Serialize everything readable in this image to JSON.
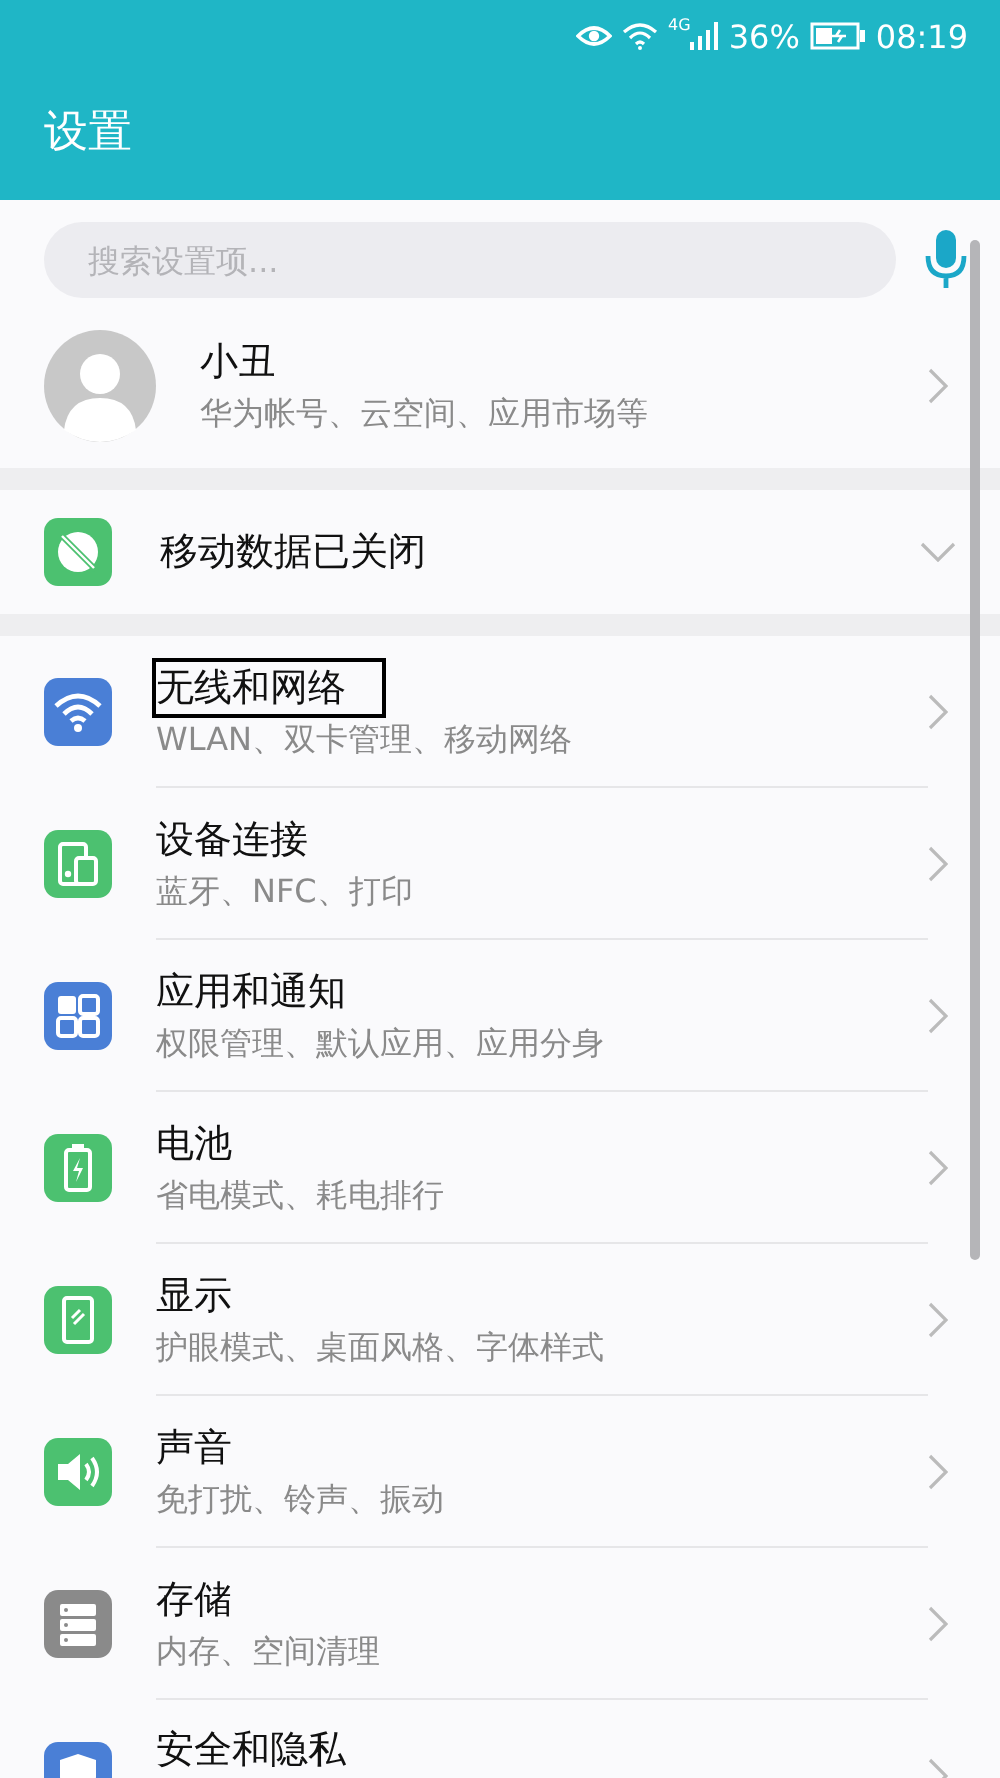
{
  "status_bar": {
    "network": "4G",
    "battery": "36%",
    "time": "08:19"
  },
  "header": {
    "title": "设置"
  },
  "search": {
    "placeholder": "搜索设置项..."
  },
  "account": {
    "name": "小丑",
    "subtitle": "华为帐号、云空间、应用市场等"
  },
  "mobile_data": {
    "label": "移动数据已关闭",
    "expanded": false
  },
  "items": [
    {
      "kind": "wifi",
      "color": "#4a7fd6",
      "title": "无线和网络",
      "subtitle": "WLAN、双卡管理、移动网络",
      "highlighted": true
    },
    {
      "kind": "devices",
      "color": "#4cc170",
      "title": "设备连接",
      "subtitle": "蓝牙、NFC、打印",
      "highlighted": false
    },
    {
      "kind": "apps",
      "color": "#4a7fd6",
      "title": "应用和通知",
      "subtitle": "权限管理、默认应用、应用分身",
      "highlighted": false
    },
    {
      "kind": "battery",
      "color": "#4cc170",
      "title": "电池",
      "subtitle": "省电模式、耗电排行",
      "highlighted": false
    },
    {
      "kind": "display",
      "color": "#4cc170",
      "title": "显示",
      "subtitle": "护眼模式、桌面风格、字体样式",
      "highlighted": false
    },
    {
      "kind": "sound",
      "color": "#4cc170",
      "title": "声音",
      "subtitle": "免打扰、铃声、振动",
      "highlighted": false
    },
    {
      "kind": "storage",
      "color": "#8a8a8a",
      "title": "存储",
      "subtitle": "内存、空间清理",
      "highlighted": false
    },
    {
      "kind": "shield",
      "color": "#4a7fd6",
      "title": "安全和隐私",
      "highlighted": false
    }
  ]
}
